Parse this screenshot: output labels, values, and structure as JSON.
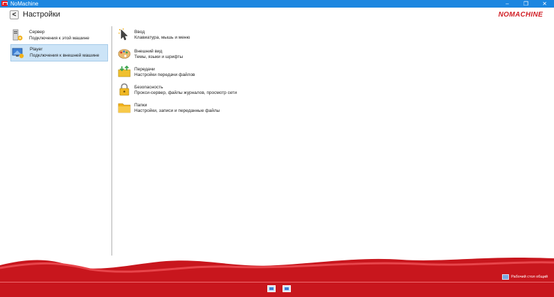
{
  "window": {
    "title": "NoMachine",
    "controls": [
      "–",
      "❐",
      "✕"
    ]
  },
  "header": {
    "back_label": "<",
    "page_title": "Настройки",
    "brand": "NOMACHINE"
  },
  "sidebar": {
    "items": [
      {
        "title": "Сервер",
        "subtitle": "Подключения к этой машине",
        "icon": "server-icon",
        "selected": false
      },
      {
        "title": "Player",
        "subtitle": "Подключения к внешней машине",
        "icon": "player-icon",
        "selected": true
      }
    ]
  },
  "main": {
    "items": [
      {
        "title": "Ввод",
        "subtitle": "Клавиатура, мышь и меню",
        "icon": "input-icon"
      },
      {
        "title": "Внешний вид",
        "subtitle": "Темы, языки и шрифты",
        "icon": "palette-icon"
      },
      {
        "title": "Передачи",
        "subtitle": "Настройки передачи файлов",
        "icon": "transfer-icon"
      },
      {
        "title": "Безопасность",
        "subtitle": "Прокси-сервер, файлы журналов, просмотр сети",
        "icon": "lock-icon"
      },
      {
        "title": "Папки",
        "subtitle": "Настройки, записи и переданные файлы",
        "icon": "folder-icon"
      }
    ]
  },
  "footer": {
    "remote_label": "Рабочий стол общий"
  },
  "colors": {
    "accent": "#1c86e0",
    "brand_red": "#d11f26",
    "selection": "#cce4f7"
  }
}
